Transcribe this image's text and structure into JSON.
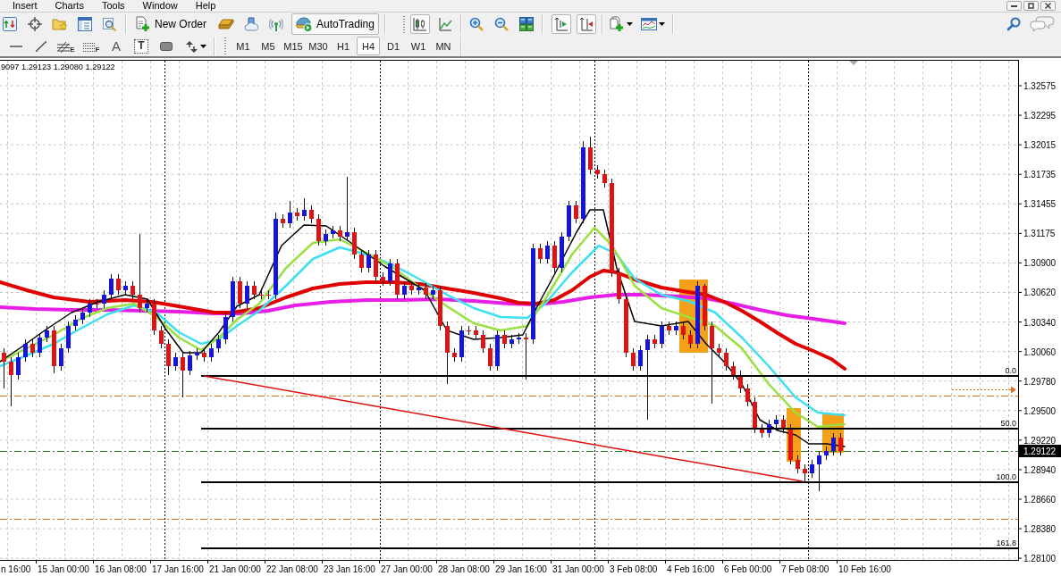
{
  "menu_bar": {
    "items": [
      "Insert",
      "Charts",
      "Tools",
      "Window",
      "Help"
    ]
  },
  "standard_toolbar": {
    "new_order": "New Order",
    "autotrading": {
      "label": "AutoTrading",
      "on": true
    },
    "chart_types": [
      {
        "selected": true
      },
      {
        "selected": false
      }
    ],
    "auto_scroll": {
      "on": true
    },
    "chart_shift": {
      "on": true
    }
  },
  "line_studies_toolbar": {
    "fibonacci_tools": [
      "E",
      "F"
    ],
    "text_tool": "A",
    "text_label_tool": "T"
  },
  "timeframes": [
    {
      "label": "M1",
      "selected": false
    },
    {
      "label": "M5",
      "selected": false
    },
    {
      "label": "M15",
      "selected": false
    },
    {
      "label": "M30",
      "selected": false
    },
    {
      "label": "H1",
      "selected": false
    },
    {
      "label": "H4",
      "selected": true
    },
    {
      "label": "D1",
      "selected": false
    },
    {
      "label": "W1",
      "selected": false
    },
    {
      "label": "MN",
      "selected": false
    }
  ],
  "chart": {
    "info": "9097 1.29123 1.29080 1.29122",
    "price_axis": [
      "1.32575",
      "1.32295",
      "1.32015",
      "1.31735",
      "1.31455",
      "1.31175",
      "1.30900",
      "1.30620",
      "1.30340",
      "1.30060",
      "1.29780",
      "1.29500",
      "1.29220",
      "1.28940",
      "1.28660",
      "1.28380",
      "1.28100"
    ],
    "current_price": "1.29122",
    "time_axis": [
      "n 16:00",
      "15 Jan 00:00",
      "16 Jan 08:00",
      "17 Jan 16:00",
      "21 Jan 00:00",
      "22 Jan 08:00",
      "23 Jan 16:00",
      "27 Jan 00:00",
      "28 Jan 08:00",
      "29 Jan 16:00",
      "31 Jan 00:00",
      "3 Feb 08:00",
      "4 Feb 16:00",
      "6 Feb 00:00",
      "7 Feb 08:00",
      "10 Feb 16:00"
    ],
    "fibonacci_levels": [
      "0.0",
      "50.0",
      "100.0",
      "161.8"
    ]
  }
}
